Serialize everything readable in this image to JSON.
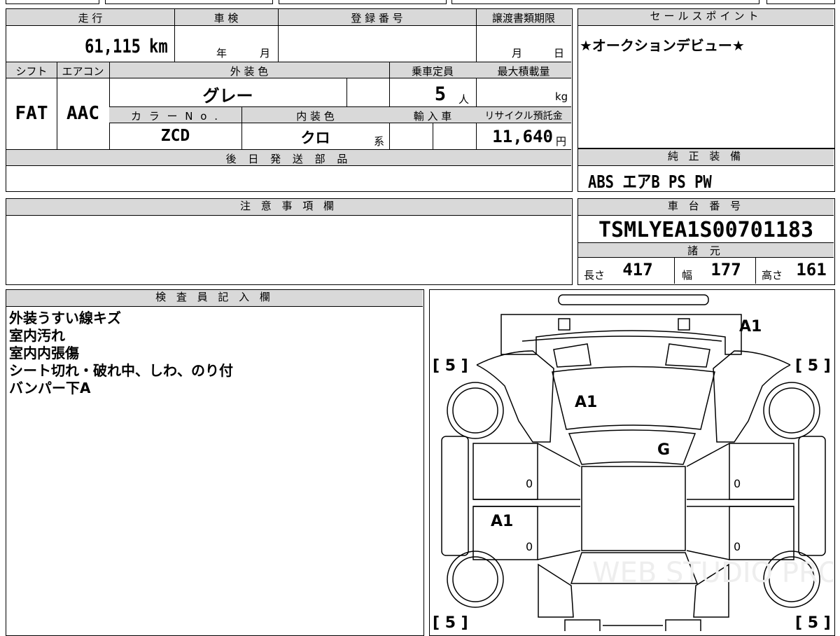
{
  "top_box": {
    "mileage_label": "走 行",
    "mileage_value": "61,115",
    "mileage_unit": "km",
    "inspection_label": "車 検",
    "inspection_year": "年",
    "inspection_month": "月",
    "registration_label": "登 録 番 号",
    "registration_value": "",
    "transfer_label": "譲渡書類期限",
    "transfer_month": "月",
    "transfer_day": "日",
    "shift_label": "シフト",
    "shift_value": "FAT",
    "aircon_label": "エアコン",
    "aircon_value": "AAC",
    "ext_color_label": "外 装 色",
    "ext_color_value": "グレー",
    "capacity_label": "乗車定員",
    "capacity_value": "5",
    "capacity_unit": "人",
    "max_load_label": "最大積載量",
    "max_load_unit": "kg",
    "color_no_label": "カ ラ ー N o .",
    "color_no_value": "ZCD",
    "int_color_label": "内 装 色",
    "int_color_value": "クロ",
    "int_color_suffix": "系",
    "import_label": "輸 入 車",
    "recycle_label": "リサイクル預託金",
    "recycle_value": "11,640",
    "recycle_unit": "円",
    "later_parts_label": "後 日 発 送 部 品"
  },
  "sales_point": {
    "label": "セールスポイント",
    "text": "★オークションデビュー★"
  },
  "equipment": {
    "label": "純 正 装 備",
    "text": "ABS エアB PS PW"
  },
  "caution": {
    "label": "注 意 事 項 欄"
  },
  "chassis": {
    "label": "車 台 番 号",
    "value": "TSMLYEA1S00701183",
    "spec_label": "諸 元",
    "length_label": "長さ",
    "length_value": "417",
    "width_label": "幅",
    "width_value": "177",
    "height_label": "高さ",
    "height_value": "161"
  },
  "inspector": {
    "label": "検 査 員 記 入 欄",
    "lines": [
      "外装うすい線キズ",
      "室内汚れ",
      "室内内張傷",
      "シート切れ・破れ中、しわ、のり付",
      "バンパー下A"
    ]
  },
  "diagram": {
    "tires": [
      "[ 5 ]",
      "[ 5 ]",
      "[ 5 ]",
      "[ 5 ]"
    ],
    "marks": [
      "A1",
      "A1",
      "G",
      "A1"
    ],
    "panel_values": [
      "0",
      "0",
      "0",
      "0"
    ],
    "watermark": "WEB STUDIO PRO"
  },
  "colors": {
    "header_bg": "#d9d9d9",
    "line": "#000000"
  }
}
